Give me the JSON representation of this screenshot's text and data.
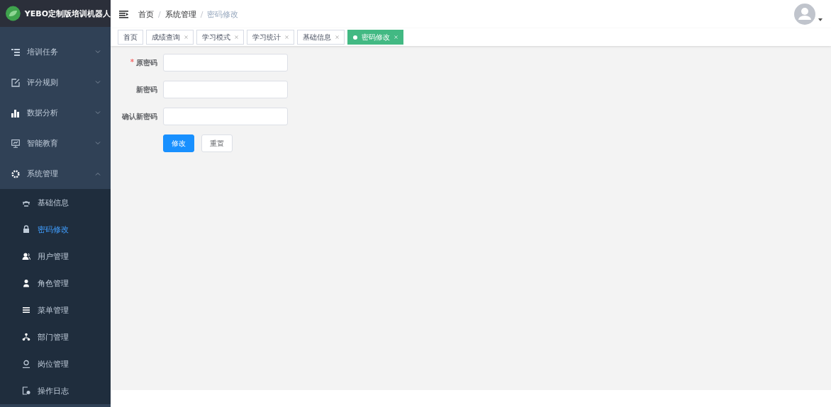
{
  "logo": {
    "title": "YEBO定制版培训机器人"
  },
  "sidebar": {
    "items": [
      {
        "label": "培训任务",
        "expanded": false
      },
      {
        "label": "评分规则",
        "expanded": false
      },
      {
        "label": "数据分析",
        "expanded": false
      },
      {
        "label": "智能教育",
        "expanded": false
      },
      {
        "label": "系统管理",
        "expanded": true,
        "children": [
          {
            "label": "基础信息",
            "selected": false
          },
          {
            "label": "密码修改",
            "selected": true
          },
          {
            "label": "用户管理",
            "selected": false
          },
          {
            "label": "角色管理",
            "selected": false
          },
          {
            "label": "菜单管理",
            "selected": false
          },
          {
            "label": "部门管理",
            "selected": false
          },
          {
            "label": "岗位管理",
            "selected": false
          },
          {
            "label": "操作日志",
            "selected": false
          }
        ]
      }
    ]
  },
  "breadcrumb": [
    {
      "label": "首页"
    },
    {
      "separator": "/",
      "label": "系统管理"
    },
    {
      "separator": "/",
      "label": "密码修改"
    }
  ],
  "tags": [
    {
      "label": "首页",
      "closable": false,
      "selected": false
    },
    {
      "label": "成绩查询",
      "closable": true,
      "selected": false
    },
    {
      "label": "学习模式",
      "closable": true,
      "selected": false
    },
    {
      "label": "学习统计",
      "closable": true,
      "selected": false
    },
    {
      "label": "基础信息",
      "closable": true,
      "selected": false
    },
    {
      "label": "密码修改",
      "closable": true,
      "selected": true
    }
  ],
  "form": {
    "fields": [
      {
        "label": "原密码",
        "required_mark": "*"
      },
      {
        "label": "新密码"
      },
      {
        "label": "确认新密码"
      }
    ],
    "buttons": [
      {
        "label": "修改",
        "kind": "primary"
      },
      {
        "label": "重置",
        "kind": "default"
      }
    ]
  }
}
